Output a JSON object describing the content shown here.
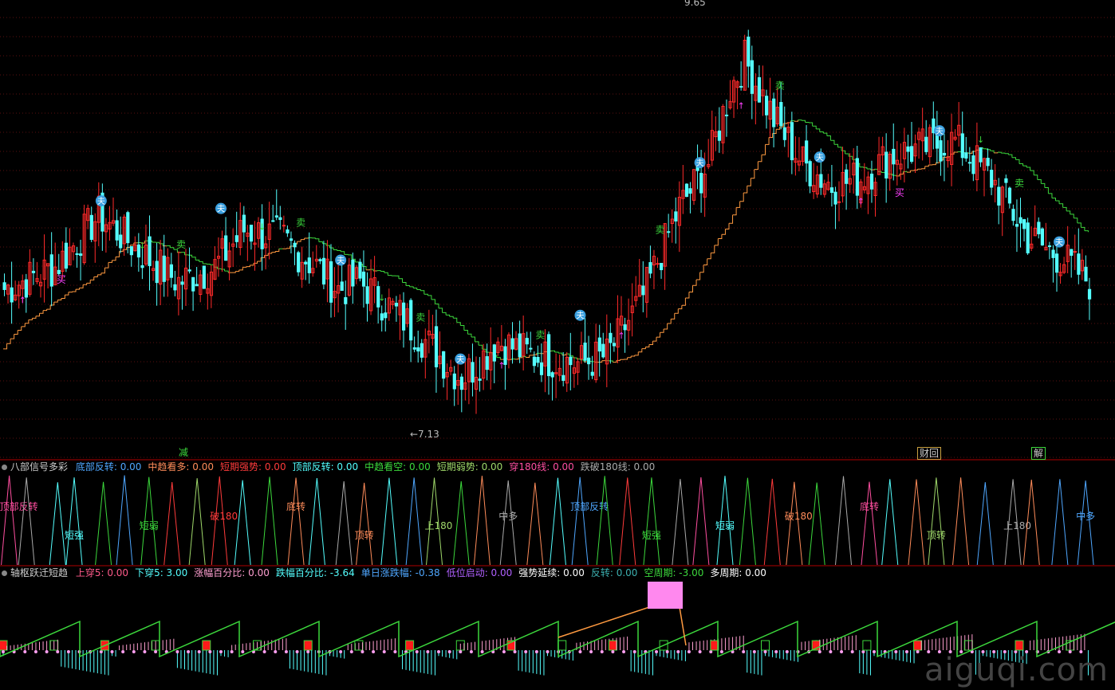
{
  "chart_data": [
    {
      "type": "candlestick",
      "title": "",
      "high_label": "9.65",
      "low_label": "←7.13",
      "ylim": [
        6.9,
        10.0
      ],
      "grid": true,
      "colors": {
        "up": "#ff2a2a",
        "down": "#54ffff",
        "stair_up": "#ff9a40",
        "stair_down": "#3cd83c",
        "buy": "#ff40ff",
        "sell": "#3cd83c"
      },
      "ohlc_anchors": [
        [
          0,
          8.05
        ],
        [
          14,
          8.2
        ],
        [
          26,
          8.55
        ],
        [
          40,
          8.25
        ],
        [
          48,
          8.1
        ],
        [
          58,
          8.2
        ],
        [
          66,
          8.45
        ],
        [
          76,
          8.4
        ],
        [
          86,
          8.2
        ],
        [
          92,
          8.05
        ],
        [
          98,
          8.1
        ],
        [
          110,
          7.85
        ],
        [
          126,
          7.45
        ],
        [
          136,
          7.7
        ],
        [
          146,
          7.6
        ],
        [
          158,
          7.55
        ],
        [
          166,
          7.6
        ],
        [
          176,
          8.0
        ],
        [
          186,
          8.6
        ],
        [
          194,
          8.9
        ],
        [
          200,
          9.4
        ],
        [
          204,
          9.6
        ],
        [
          212,
          9.2
        ],
        [
          220,
          8.9
        ],
        [
          228,
          8.75
        ],
        [
          236,
          8.8
        ],
        [
          244,
          8.95
        ],
        [
          252,
          9.0
        ],
        [
          262,
          9.05
        ],
        [
          272,
          8.8
        ],
        [
          282,
          8.4
        ],
        [
          292,
          8.25
        ],
        [
          299,
          8.1
        ]
      ],
      "markers_text": {
        "buy": "买",
        "sell": "卖",
        "rise": "↑",
        "fall": "↓",
        "fu": "夫"
      },
      "bottom_labels": [
        "减",
        "财回",
        "解"
      ]
    },
    {
      "type": "signal",
      "title": "八部信号多彩",
      "items": [
        {
          "label": "底部反转:",
          "value": "0.00",
          "color": "#4fa7ff"
        },
        {
          "label": "中趋看多:",
          "value": "0.00",
          "color": "#ff8c5a"
        },
        {
          "label": "短期强势:",
          "value": "0.00",
          "color": "#ff3b3b"
        },
        {
          "label": "顶部反转:",
          "value": "0.00",
          "color": "#54ffff"
        },
        {
          "label": "中趋看空:",
          "value": "0.00",
          "color": "#3cd83c"
        },
        {
          "label": "短期弱势:",
          "value": "0.00",
          "color": "#9fd86a"
        },
        {
          "label": "穿180线:",
          "value": "0.00",
          "color": "#ff4fa0"
        },
        {
          "label": "跌破180线:",
          "value": "0.00",
          "color": "#aaaaaa"
        }
      ],
      "labels": [
        "顶部反转",
        "破180",
        "上180",
        "短强",
        "底转",
        "中多",
        "短弱",
        "顶转"
      ]
    },
    {
      "type": "histogram",
      "title": "轴枢跃迁短趋",
      "items": [
        {
          "label": "上穿5:",
          "value": "0.00",
          "color": "#ff5a8a"
        },
        {
          "label": "下穿5:",
          "value": "3.00",
          "color": "#54ffff"
        },
        {
          "label": "涨幅百分比:",
          "value": "0.00",
          "color": "#ff9fd0"
        },
        {
          "label": "跌幅百分比:",
          "value": "-3.64",
          "color": "#54ffff"
        },
        {
          "label": "单日涨跌幅:",
          "value": "-0.38",
          "color": "#4fa7ff"
        },
        {
          "label": "低位启动:",
          "value": "0.00",
          "color": "#b060ff"
        },
        {
          "label": "强势延续:",
          "value": "0.00",
          "color": "#ffffff"
        },
        {
          "label": "反转:",
          "value": "0.00",
          "color": "#3cb0b0"
        },
        {
          "label": "空周期:",
          "value": "-3.00",
          "color": "#3cd83c"
        },
        {
          "label": "多周期:",
          "value": "0.00",
          "color": "#ffffff"
        }
      ]
    }
  ],
  "watermark": "aiguqi.com"
}
